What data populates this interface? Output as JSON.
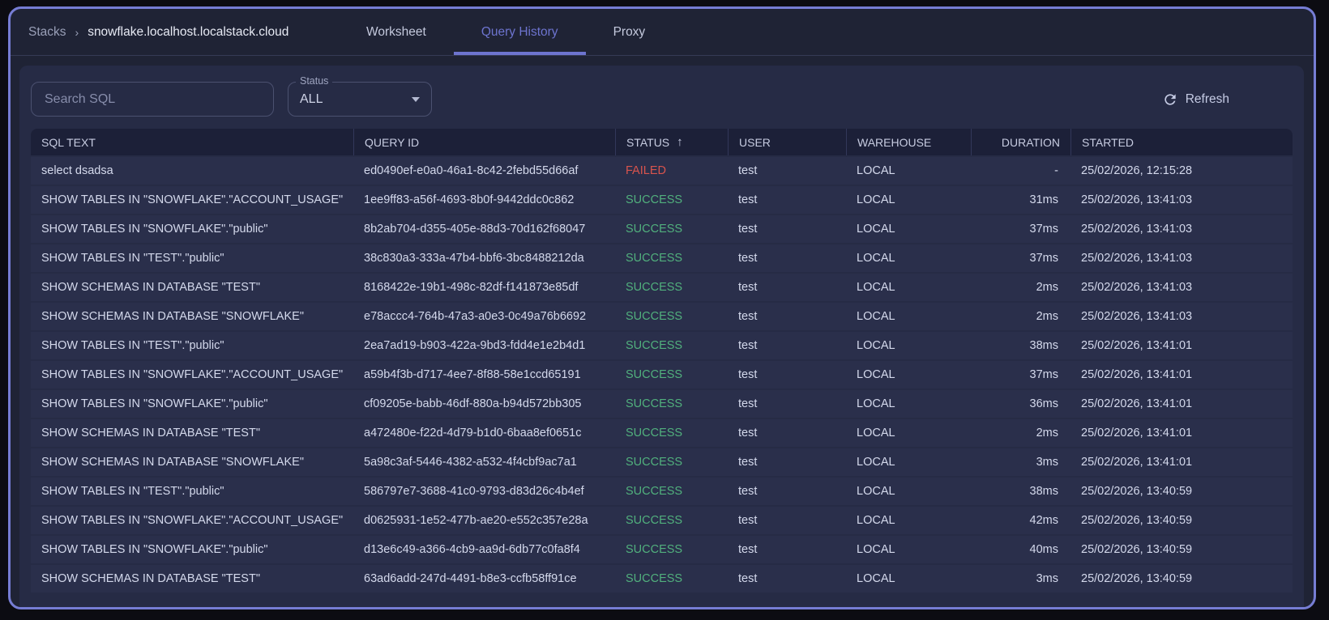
{
  "breadcrumb": {
    "root": "Stacks",
    "separator": "›",
    "current": "snowflake.localhost.localstack.cloud"
  },
  "tabs": [
    {
      "label": "Worksheet",
      "active": false
    },
    {
      "label": "Query History",
      "active": true
    },
    {
      "label": "Proxy",
      "active": false
    }
  ],
  "controls": {
    "search_placeholder": "Search SQL",
    "status_filter": {
      "label": "Status",
      "value": "ALL"
    },
    "refresh_label": "Refresh",
    "refresh_icon": "refresh-icon"
  },
  "table": {
    "columns": [
      {
        "key": "sql",
        "label": "SQL TEXT"
      },
      {
        "key": "query_id",
        "label": "QUERY ID"
      },
      {
        "key": "status",
        "label": "STATUS"
      },
      {
        "key": "user",
        "label": "USER"
      },
      {
        "key": "warehouse",
        "label": "WAREHOUSE"
      },
      {
        "key": "duration",
        "label": "DURATION"
      },
      {
        "key": "started",
        "label": "STARTED"
      }
    ],
    "sort": {
      "column": "STATUS",
      "direction": "asc",
      "icon": "arrow-up-icon",
      "glyph": "↑"
    },
    "rows": [
      {
        "sql": "select dsadsa",
        "query_id": "ed0490ef-e0a0-46a1-8c42-2febd55d66af",
        "status": "FAILED",
        "user": "test",
        "warehouse": "LOCAL",
        "duration": "-",
        "started": "25/02/2026, 12:15:28"
      },
      {
        "sql": "SHOW TABLES IN \"SNOWFLAKE\".\"ACCOUNT_USAGE\"",
        "query_id": "1ee9ff83-a56f-4693-8b0f-9442ddc0c862",
        "status": "SUCCESS",
        "user": "test",
        "warehouse": "LOCAL",
        "duration": "31ms",
        "started": "25/02/2026, 13:41:03"
      },
      {
        "sql": "SHOW TABLES IN \"SNOWFLAKE\".\"public\"",
        "query_id": "8b2ab704-d355-405e-88d3-70d162f68047",
        "status": "SUCCESS",
        "user": "test",
        "warehouse": "LOCAL",
        "duration": "37ms",
        "started": "25/02/2026, 13:41:03"
      },
      {
        "sql": "SHOW TABLES IN \"TEST\".\"public\"",
        "query_id": "38c830a3-333a-47b4-bbf6-3bc8488212da",
        "status": "SUCCESS",
        "user": "test",
        "warehouse": "LOCAL",
        "duration": "37ms",
        "started": "25/02/2026, 13:41:03"
      },
      {
        "sql": "SHOW SCHEMAS IN DATABASE \"TEST\"",
        "query_id": "8168422e-19b1-498c-82df-f141873e85df",
        "status": "SUCCESS",
        "user": "test",
        "warehouse": "LOCAL",
        "duration": "2ms",
        "started": "25/02/2026, 13:41:03"
      },
      {
        "sql": "SHOW SCHEMAS IN DATABASE \"SNOWFLAKE\"",
        "query_id": "e78accc4-764b-47a3-a0e3-0c49a76b6692",
        "status": "SUCCESS",
        "user": "test",
        "warehouse": "LOCAL",
        "duration": "2ms",
        "started": "25/02/2026, 13:41:03"
      },
      {
        "sql": "SHOW TABLES IN \"TEST\".\"public\"",
        "query_id": "2ea7ad19-b903-422a-9bd3-fdd4e1e2b4d1",
        "status": "SUCCESS",
        "user": "test",
        "warehouse": "LOCAL",
        "duration": "38ms",
        "started": "25/02/2026, 13:41:01"
      },
      {
        "sql": "SHOW TABLES IN \"SNOWFLAKE\".\"ACCOUNT_USAGE\"",
        "query_id": "a59b4f3b-d717-4ee7-8f88-58e1ccd65191",
        "status": "SUCCESS",
        "user": "test",
        "warehouse": "LOCAL",
        "duration": "37ms",
        "started": "25/02/2026, 13:41:01"
      },
      {
        "sql": "SHOW TABLES IN \"SNOWFLAKE\".\"public\"",
        "query_id": "cf09205e-babb-46df-880a-b94d572bb305",
        "status": "SUCCESS",
        "user": "test",
        "warehouse": "LOCAL",
        "duration": "36ms",
        "started": "25/02/2026, 13:41:01"
      },
      {
        "sql": "SHOW SCHEMAS IN DATABASE \"TEST\"",
        "query_id": "a472480e-f22d-4d79-b1d0-6baa8ef0651c",
        "status": "SUCCESS",
        "user": "test",
        "warehouse": "LOCAL",
        "duration": "2ms",
        "started": "25/02/2026, 13:41:01"
      },
      {
        "sql": "SHOW SCHEMAS IN DATABASE \"SNOWFLAKE\"",
        "query_id": "5a98c3af-5446-4382-a532-4f4cbf9ac7a1",
        "status": "SUCCESS",
        "user": "test",
        "warehouse": "LOCAL",
        "duration": "3ms",
        "started": "25/02/2026, 13:41:01"
      },
      {
        "sql": "SHOW TABLES IN \"TEST\".\"public\"",
        "query_id": "586797e7-3688-41c0-9793-d83d26c4b4ef",
        "status": "SUCCESS",
        "user": "test",
        "warehouse": "LOCAL",
        "duration": "38ms",
        "started": "25/02/2026, 13:40:59"
      },
      {
        "sql": "SHOW TABLES IN \"SNOWFLAKE\".\"ACCOUNT_USAGE\"",
        "query_id": "d0625931-1e52-477b-ae20-e552c357e28a",
        "status": "SUCCESS",
        "user": "test",
        "warehouse": "LOCAL",
        "duration": "42ms",
        "started": "25/02/2026, 13:40:59"
      },
      {
        "sql": "SHOW TABLES IN \"SNOWFLAKE\".\"public\"",
        "query_id": "d13e6c49-a366-4cb9-aa9d-6db77c0fa8f4",
        "status": "SUCCESS",
        "user": "test",
        "warehouse": "LOCAL",
        "duration": "40ms",
        "started": "25/02/2026, 13:40:59"
      },
      {
        "sql": "SHOW SCHEMAS IN DATABASE \"TEST\"",
        "query_id": "63ad6add-247d-4491-b8e3-ccfb58ff91ce",
        "status": "SUCCESS",
        "user": "test",
        "warehouse": "LOCAL",
        "duration": "3ms",
        "started": "25/02/2026, 13:40:59"
      }
    ]
  },
  "colors": {
    "accent": "#6d74cf",
    "frame_border": "#767dd4",
    "success": "#51b07d",
    "failed": "#d9544d"
  }
}
